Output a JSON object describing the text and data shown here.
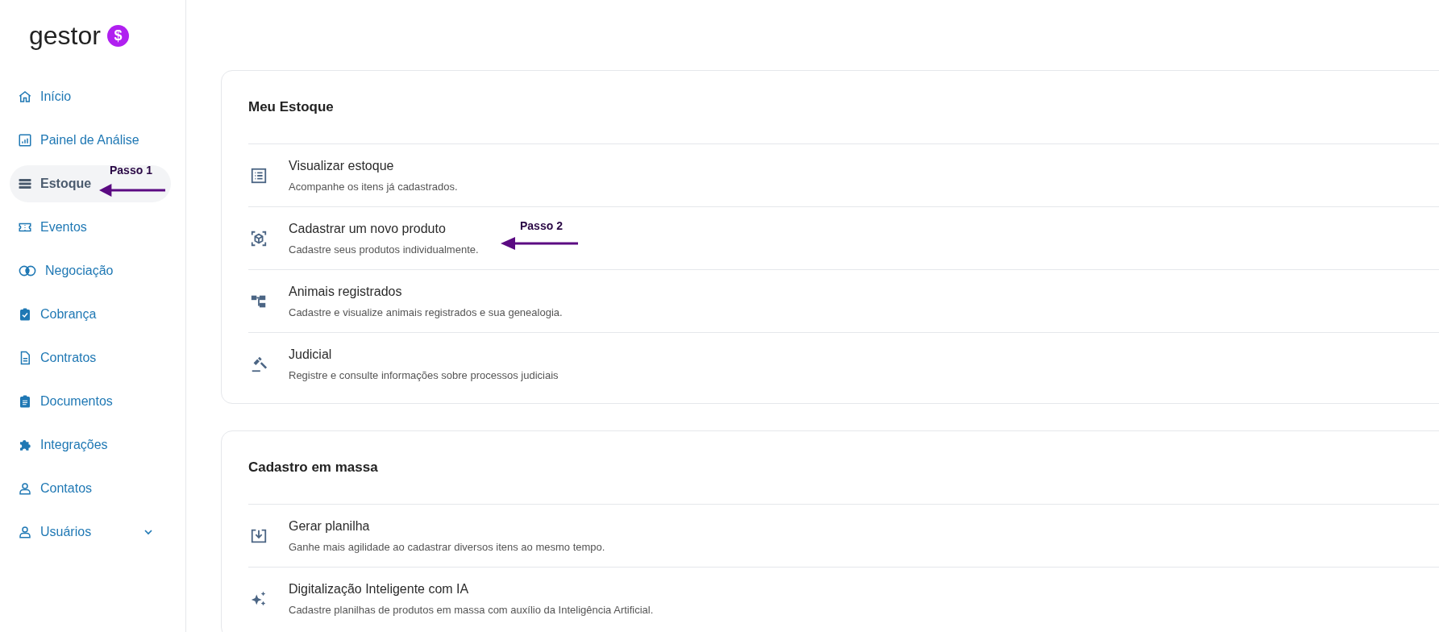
{
  "sidebar": {
    "logo": {
      "text": "gestor",
      "badge": "$"
    },
    "items": [
      {
        "label": "Início",
        "selected": false,
        "expandable": false
      },
      {
        "label": "Painel de Análise",
        "selected": false,
        "expandable": false
      },
      {
        "label": "Estoque",
        "selected": true,
        "expandable": false
      },
      {
        "label": "Eventos",
        "selected": false,
        "expandable": false
      },
      {
        "label": "Negociação",
        "selected": false,
        "expandable": false
      },
      {
        "label": "Cobrança",
        "selected": false,
        "expandable": false
      },
      {
        "label": "Contratos",
        "selected": false,
        "expandable": false
      },
      {
        "label": "Documentos",
        "selected": false,
        "expandable": false
      },
      {
        "label": "Integrações",
        "selected": false,
        "expandable": false
      },
      {
        "label": "Contatos",
        "selected": false,
        "expandable": false
      },
      {
        "label": "Usuários",
        "selected": false,
        "expandable": true
      }
    ]
  },
  "cards": [
    {
      "title": "Meu Estoque",
      "rows": [
        {
          "title": "Visualizar estoque",
          "description": "Acompanhe os itens já cadastrados."
        },
        {
          "title": "Cadastrar um novo produto",
          "description": "Cadastre seus produtos individualmente."
        },
        {
          "title": "Animais registrados",
          "description": "Cadastre e visualize animais registrados e sua genealogia."
        },
        {
          "title": "Judicial",
          "description": "Registre e consulte informações sobre processos judiciais"
        }
      ]
    },
    {
      "title": "Cadastro em massa",
      "rows": [
        {
          "title": "Gerar planilha",
          "description": "Ganhe mais agilidade ao cadastrar diversos itens ao mesmo tempo."
        },
        {
          "title": "Digitalização Inteligente com IA",
          "description": "Cadastre planilhas de produtos em massa com auxílio da Inteligência Artificial."
        }
      ]
    }
  ],
  "annotations": [
    {
      "label": "Passo 1"
    },
    {
      "label": "Passo 2"
    }
  ]
}
